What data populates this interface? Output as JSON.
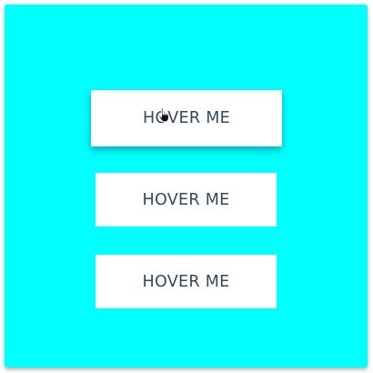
{
  "buttons": [
    {
      "label": "HOVER ME",
      "state": "hovered"
    },
    {
      "label": "HOVER ME",
      "state": "normal"
    },
    {
      "label": "HOVER ME",
      "state": "normal"
    }
  ],
  "cursor": {
    "icon": "hand-pointer-icon"
  },
  "colors": {
    "panel_background": "#00ffff",
    "button_background": "#ffffff",
    "button_text": "#34495e"
  }
}
